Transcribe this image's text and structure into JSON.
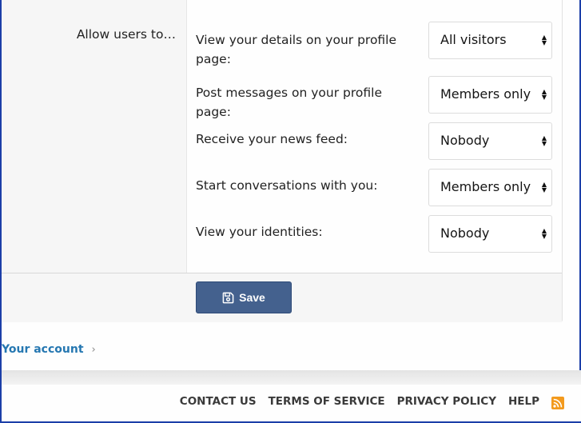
{
  "section": {
    "row_label": "Allow users to…",
    "preferences": [
      {
        "label": "View your details on your profile page:",
        "value": "All visitors"
      },
      {
        "label": "Post messages on your profile page:",
        "value": "Members only"
      },
      {
        "label": "Receive your news feed:",
        "value": "Nobody"
      },
      {
        "label": "Start conversations with you:",
        "value": "Members only"
      },
      {
        "label": "View your identities:",
        "value": "Nobody"
      }
    ]
  },
  "actions": {
    "save_label": "Save",
    "save_icon": "floppy-disk-icon"
  },
  "breadcrumb": {
    "item": "Your account",
    "separator_icon": "chevron-right-icon"
  },
  "footer": {
    "links": [
      "CONTACT US",
      "TERMS OF SERVICE",
      "PRIVACY POLICY",
      "HELP"
    ],
    "rss_icon": "rss-icon"
  },
  "colors": {
    "button": "#44618e",
    "link": "#2577b1",
    "rss": "#f39a1d",
    "frame_border": "#1c3fa8"
  }
}
